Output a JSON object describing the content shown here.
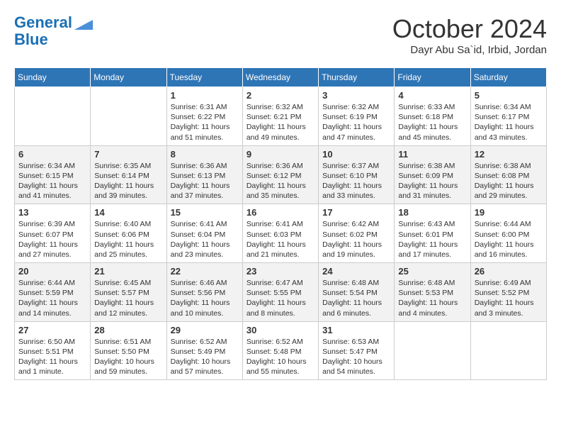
{
  "header": {
    "logo_line1": "General",
    "logo_line2": "Blue",
    "month": "October 2024",
    "location": "Dayr Abu Sa`id, Irbid, Jordan"
  },
  "weekdays": [
    "Sunday",
    "Monday",
    "Tuesday",
    "Wednesday",
    "Thursday",
    "Friday",
    "Saturday"
  ],
  "weeks": [
    [
      {
        "day": "",
        "info": ""
      },
      {
        "day": "",
        "info": ""
      },
      {
        "day": "1",
        "info": "Sunrise: 6:31 AM\nSunset: 6:22 PM\nDaylight: 11 hours and 51 minutes."
      },
      {
        "day": "2",
        "info": "Sunrise: 6:32 AM\nSunset: 6:21 PM\nDaylight: 11 hours and 49 minutes."
      },
      {
        "day": "3",
        "info": "Sunrise: 6:32 AM\nSunset: 6:19 PM\nDaylight: 11 hours and 47 minutes."
      },
      {
        "day": "4",
        "info": "Sunrise: 6:33 AM\nSunset: 6:18 PM\nDaylight: 11 hours and 45 minutes."
      },
      {
        "day": "5",
        "info": "Sunrise: 6:34 AM\nSunset: 6:17 PM\nDaylight: 11 hours and 43 minutes."
      }
    ],
    [
      {
        "day": "6",
        "info": "Sunrise: 6:34 AM\nSunset: 6:15 PM\nDaylight: 11 hours and 41 minutes."
      },
      {
        "day": "7",
        "info": "Sunrise: 6:35 AM\nSunset: 6:14 PM\nDaylight: 11 hours and 39 minutes."
      },
      {
        "day": "8",
        "info": "Sunrise: 6:36 AM\nSunset: 6:13 PM\nDaylight: 11 hours and 37 minutes."
      },
      {
        "day": "9",
        "info": "Sunrise: 6:36 AM\nSunset: 6:12 PM\nDaylight: 11 hours and 35 minutes."
      },
      {
        "day": "10",
        "info": "Sunrise: 6:37 AM\nSunset: 6:10 PM\nDaylight: 11 hours and 33 minutes."
      },
      {
        "day": "11",
        "info": "Sunrise: 6:38 AM\nSunset: 6:09 PM\nDaylight: 11 hours and 31 minutes."
      },
      {
        "day": "12",
        "info": "Sunrise: 6:38 AM\nSunset: 6:08 PM\nDaylight: 11 hours and 29 minutes."
      }
    ],
    [
      {
        "day": "13",
        "info": "Sunrise: 6:39 AM\nSunset: 6:07 PM\nDaylight: 11 hours and 27 minutes."
      },
      {
        "day": "14",
        "info": "Sunrise: 6:40 AM\nSunset: 6:06 PM\nDaylight: 11 hours and 25 minutes."
      },
      {
        "day": "15",
        "info": "Sunrise: 6:41 AM\nSunset: 6:04 PM\nDaylight: 11 hours and 23 minutes."
      },
      {
        "day": "16",
        "info": "Sunrise: 6:41 AM\nSunset: 6:03 PM\nDaylight: 11 hours and 21 minutes."
      },
      {
        "day": "17",
        "info": "Sunrise: 6:42 AM\nSunset: 6:02 PM\nDaylight: 11 hours and 19 minutes."
      },
      {
        "day": "18",
        "info": "Sunrise: 6:43 AM\nSunset: 6:01 PM\nDaylight: 11 hours and 17 minutes."
      },
      {
        "day": "19",
        "info": "Sunrise: 6:44 AM\nSunset: 6:00 PM\nDaylight: 11 hours and 16 minutes."
      }
    ],
    [
      {
        "day": "20",
        "info": "Sunrise: 6:44 AM\nSunset: 5:59 PM\nDaylight: 11 hours and 14 minutes."
      },
      {
        "day": "21",
        "info": "Sunrise: 6:45 AM\nSunset: 5:57 PM\nDaylight: 11 hours and 12 minutes."
      },
      {
        "day": "22",
        "info": "Sunrise: 6:46 AM\nSunset: 5:56 PM\nDaylight: 11 hours and 10 minutes."
      },
      {
        "day": "23",
        "info": "Sunrise: 6:47 AM\nSunset: 5:55 PM\nDaylight: 11 hours and 8 minutes."
      },
      {
        "day": "24",
        "info": "Sunrise: 6:48 AM\nSunset: 5:54 PM\nDaylight: 11 hours and 6 minutes."
      },
      {
        "day": "25",
        "info": "Sunrise: 6:48 AM\nSunset: 5:53 PM\nDaylight: 11 hours and 4 minutes."
      },
      {
        "day": "26",
        "info": "Sunrise: 6:49 AM\nSunset: 5:52 PM\nDaylight: 11 hours and 3 minutes."
      }
    ],
    [
      {
        "day": "27",
        "info": "Sunrise: 6:50 AM\nSunset: 5:51 PM\nDaylight: 11 hours and 1 minute."
      },
      {
        "day": "28",
        "info": "Sunrise: 6:51 AM\nSunset: 5:50 PM\nDaylight: 10 hours and 59 minutes."
      },
      {
        "day": "29",
        "info": "Sunrise: 6:52 AM\nSunset: 5:49 PM\nDaylight: 10 hours and 57 minutes."
      },
      {
        "day": "30",
        "info": "Sunrise: 6:52 AM\nSunset: 5:48 PM\nDaylight: 10 hours and 55 minutes."
      },
      {
        "day": "31",
        "info": "Sunrise: 6:53 AM\nSunset: 5:47 PM\nDaylight: 10 hours and 54 minutes."
      },
      {
        "day": "",
        "info": ""
      },
      {
        "day": "",
        "info": ""
      }
    ]
  ]
}
